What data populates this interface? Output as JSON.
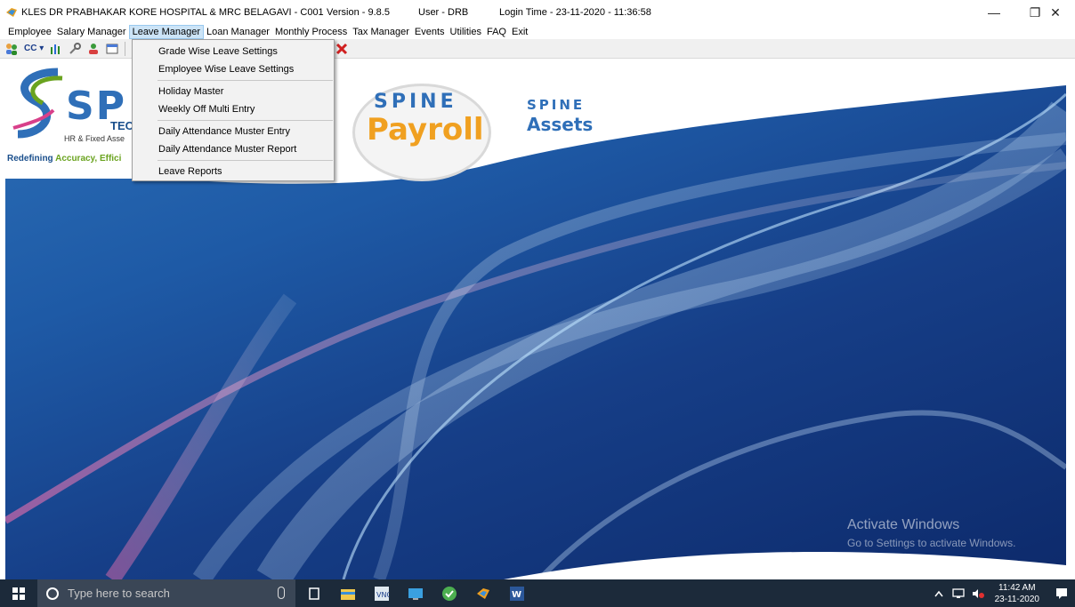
{
  "titlebar": {
    "company": "KLES DR PRABHAKAR KORE HOSPITAL & MRC BELAGAVI  -  C001",
    "version": "Version - 9.8.5",
    "user": "User - DRB",
    "login_time": "Login Time - 23-11-2020 - 11:36:58",
    "minimize_glyph": "—",
    "maximize_glyph": "❐",
    "close_glyph": "✕"
  },
  "menubar": {
    "items": [
      "Employee",
      "Salary Manager",
      "Leave Manager",
      "Loan Manager",
      "Monthly Process",
      "Tax Manager",
      "Events",
      "Utilities",
      "FAQ",
      "Exit"
    ],
    "active_index": 2
  },
  "toolbar": {
    "cc_label": "CC ▾",
    "icons": [
      "users-icon",
      "bar-chart-icon",
      "tools-icon",
      "user-refresh-icon",
      "window-icon",
      "clock-icon",
      "close-red-icon"
    ]
  },
  "leave_menu": {
    "items": [
      "Grade Wise Leave Settings",
      "Employee Wise Leave Settings",
      "Holiday Master",
      "Weekly Off  Multi Entry",
      "Daily Attendance Muster Entry",
      "Daily Attendance Muster Report",
      "Leave Reports"
    ]
  },
  "branding": {
    "logo_spine": "SP",
    "logo_tec": "TEC",
    "logo_hr": "HR & Fixed Asse",
    "logo_redefining": "Redefining",
    "logo_accuracy": "Accuracy, Effici",
    "payroll_spine": "SPINE",
    "payroll_word": "Payroll",
    "assets_spine": "SPINE",
    "assets_word": "Assets"
  },
  "watermark": {
    "title": "Activate Windows",
    "subtitle": "Go to Settings to activate Windows."
  },
  "taskbar": {
    "search_placeholder": "Type here to search",
    "time": "11:42 AM",
    "date": "23-11-2020"
  },
  "colors": {
    "menu_highlight": "#cce4f7",
    "background_blue": "#1e5aa6",
    "taskbar": "#1c2a3a",
    "payroll_orange": "#f0a020",
    "spine_blue": "#2f6fb8"
  }
}
